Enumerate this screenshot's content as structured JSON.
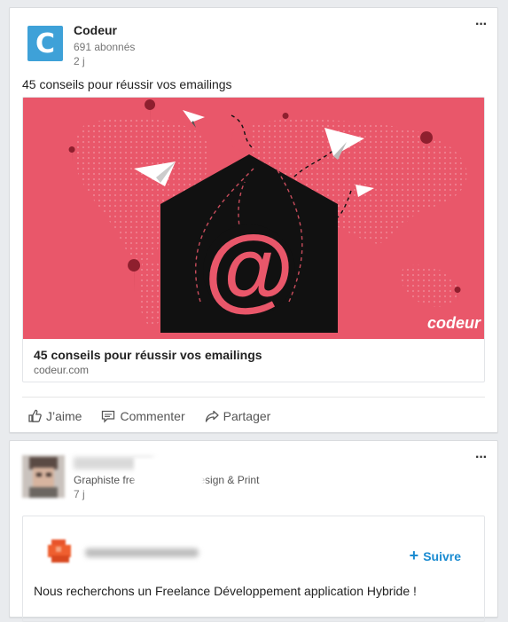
{
  "post1": {
    "author": "Codeur",
    "logo_letter": "C",
    "followers": "691 abonnés",
    "time": "2 j",
    "text": "45 conseils pour réussir vos emailings",
    "preview": {
      "title": "45 conseils pour réussir vos emailings",
      "domain": "codeur.com",
      "watermark": "codeur"
    },
    "actions": {
      "like": "J’aime",
      "comment": "Commenter",
      "share": "Partager"
    },
    "more": "···"
  },
  "post2": {
    "headline_prefix": "Graphiste fre",
    "headline_suffix": "esign & Print",
    "time": "7 j",
    "follow": "Suivre",
    "text": "Nous recherchons un Freelance Développement application Hybride !",
    "more": "···"
  },
  "colors": {
    "brand_blue": "#3ea1d8",
    "image_red": "#e9576a",
    "link_blue": "#1a8bd1"
  }
}
